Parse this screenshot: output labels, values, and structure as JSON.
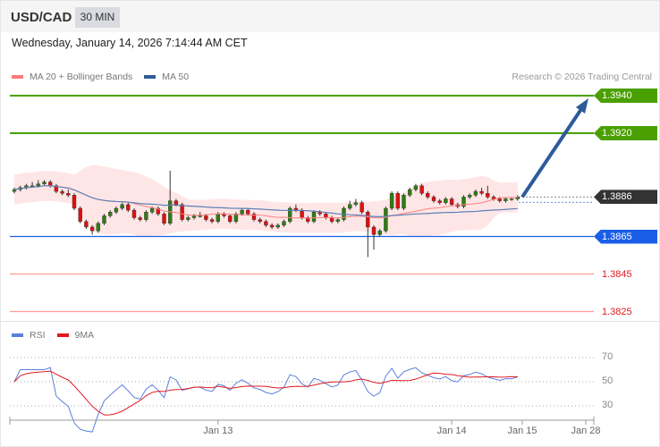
{
  "header": {
    "symbol": "USD/CAD",
    "timeframe": "30 MIN"
  },
  "date": "Wednesday, January 14, 2026 7:14:44 AM CET",
  "legend": {
    "ma20": "MA 20 + Bollinger Bands",
    "ma50": "MA 50",
    "ma20_color": "#ff7a7a",
    "ma50_color": "#2e5b9a"
  },
  "credit": "Research © 2026 Trading Central",
  "levels": [
    {
      "label": "1.3940",
      "value": 1.394,
      "color": "#4aa000",
      "type": "resistance"
    },
    {
      "label": "1.3920",
      "value": 1.392,
      "color": "#4aa000",
      "type": "resistance"
    },
    {
      "label": "1.3886",
      "value": 1.3886,
      "color": "#333333",
      "type": "last"
    },
    {
      "label": "1.3865",
      "value": 1.3865,
      "color": "#1a5ee8",
      "type": "pivot"
    },
    {
      "label": "1.3845",
      "value": 1.3845,
      "color": "#e0191e",
      "type": "support"
    },
    {
      "label": "1.3825",
      "value": 1.3825,
      "color": "#e0191e",
      "type": "support"
    }
  ],
  "price_base": 1.38,
  "pip": 0.0001,
  "candles_pips": [
    [
      89,
      91,
      88,
      90
    ],
    [
      90,
      92,
      89,
      91
    ],
    [
      91,
      93,
      90,
      92
    ],
    [
      92,
      94,
      91,
      92
    ],
    [
      92,
      95,
      91,
      93
    ],
    [
      93,
      95,
      92,
      94
    ],
    [
      94,
      95,
      91,
      92
    ],
    [
      92,
      93,
      88,
      89
    ],
    [
      89,
      90,
      87,
      88
    ],
    [
      88,
      90,
      86,
      87
    ],
    [
      87,
      88,
      79,
      80
    ],
    [
      80,
      81,
      72,
      73
    ],
    [
      73,
      74,
      69,
      70
    ],
    [
      70,
      71,
      66,
      68
    ],
    [
      68,
      73,
      67,
      72
    ],
    [
      72,
      77,
      71,
      76
    ],
    [
      76,
      79,
      75,
      78
    ],
    [
      78,
      81,
      77,
      80
    ],
    [
      80,
      83,
      79,
      82
    ],
    [
      82,
      83,
      78,
      79
    ],
    [
      79,
      80,
      74,
      75
    ],
    [
      75,
      76,
      73,
      74
    ],
    [
      74,
      79,
      73,
      78
    ],
    [
      78,
      81,
      77,
      80
    ],
    [
      80,
      81,
      76,
      77
    ],
    [
      77,
      78,
      71,
      72
    ],
    [
      72,
      100,
      71,
      84
    ],
    [
      84,
      85,
      81,
      82
    ],
    [
      82,
      83,
      73,
      74
    ],
    [
      74,
      76,
      73,
      75
    ],
    [
      75,
      77,
      74,
      76
    ],
    [
      76,
      78,
      75,
      76
    ],
    [
      76,
      77,
      73,
      74
    ],
    [
      74,
      75,
      72,
      73
    ],
    [
      73,
      78,
      72,
      77
    ],
    [
      77,
      78,
      75,
      76
    ],
    [
      76,
      77,
      72,
      73
    ],
    [
      73,
      78,
      72,
      77
    ],
    [
      77,
      80,
      76,
      79
    ],
    [
      79,
      80,
      76,
      77
    ],
    [
      77,
      78,
      73,
      74
    ],
    [
      74,
      75,
      72,
      73
    ],
    [
      73,
      74,
      70,
      71
    ],
    [
      71,
      72,
      69,
      70
    ],
    [
      70,
      72,
      69,
      71
    ],
    [
      71,
      74,
      70,
      73
    ],
    [
      73,
      81,
      72,
      80
    ],
    [
      80,
      82,
      78,
      79
    ],
    [
      79,
      80,
      74,
      75
    ],
    [
      75,
      76,
      72,
      73
    ],
    [
      73,
      79,
      72,
      78
    ],
    [
      78,
      79,
      76,
      77
    ],
    [
      77,
      78,
      74,
      75
    ],
    [
      75,
      76,
      72,
      73
    ],
    [
      73,
      75,
      72,
      74
    ],
    [
      74,
      81,
      73,
      80
    ],
    [
      80,
      84,
      79,
      82
    ],
    [
      82,
      85,
      81,
      83
    ],
    [
      83,
      84,
      77,
      78
    ],
    [
      78,
      79,
      54,
      70
    ],
    [
      70,
      71,
      58,
      66
    ],
    [
      66,
      69,
      65,
      68
    ],
    [
      68,
      81,
      67,
      80
    ],
    [
      80,
      89,
      79,
      88
    ],
    [
      88,
      89,
      79,
      80
    ],
    [
      80,
      88,
      79,
      87
    ],
    [
      87,
      91,
      86,
      90
    ],
    [
      90,
      93,
      89,
      92
    ],
    [
      92,
      93,
      87,
      88
    ],
    [
      88,
      89,
      85,
      86
    ],
    [
      86,
      87,
      83,
      84
    ],
    [
      84,
      85,
      82,
      83
    ],
    [
      83,
      86,
      82,
      85
    ],
    [
      85,
      86,
      81,
      82
    ],
    [
      82,
      83,
      80,
      81
    ],
    [
      81,
      87,
      80,
      86
    ],
    [
      86,
      88,
      85,
      87
    ],
    [
      87,
      90,
      86,
      89
    ],
    [
      89,
      91,
      87,
      88
    ],
    [
      88,
      92,
      85,
      86
    ],
    [
      86,
      87,
      84,
      85
    ],
    [
      85,
      86,
      83,
      84
    ],
    [
      84,
      86,
      83,
      85
    ],
    [
      85,
      86,
      84,
      85
    ],
    [
      85,
      87,
      84,
      86
    ]
  ],
  "rsi": {
    "label": "RSI",
    "ma_label": "9MA",
    "rsi_color": "#5b7fde",
    "ma_color": "#e0191e",
    "levels": [
      {
        "label": "70",
        "value": 70
      },
      {
        "label": "50",
        "value": 50
      },
      {
        "label": "30",
        "value": 30
      }
    ]
  },
  "xaxis": [
    {
      "label": "Jan 13",
      "index": 34
    },
    {
      "label": "Jan 14",
      "index": 73
    },
    {
      "label": "Jan 15",
      "index": 85
    },
    {
      "label": "Jan 28",
      "index": 96
    }
  ],
  "forecast": {
    "from": 1.3886,
    "to": 1.394
  }
}
